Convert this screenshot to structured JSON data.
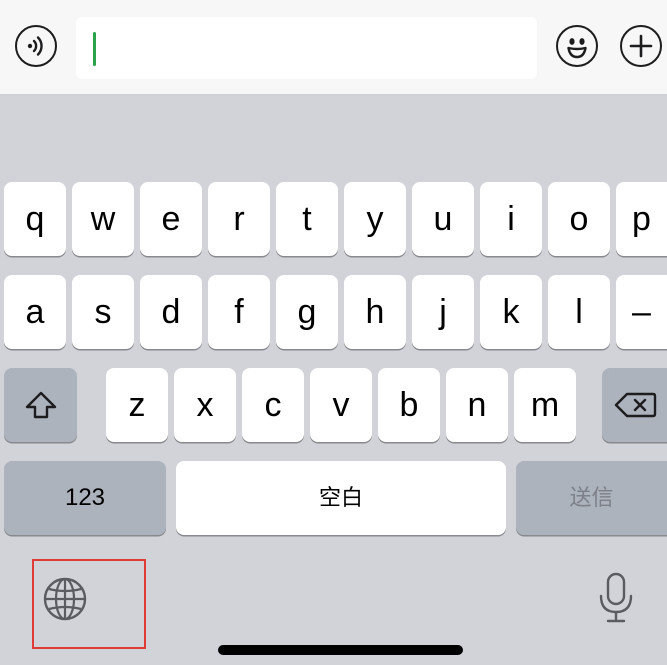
{
  "input": {
    "value": ""
  },
  "keyboard": {
    "row1": [
      "q",
      "w",
      "e",
      "r",
      "t",
      "y",
      "u",
      "i",
      "o",
      "p"
    ],
    "row2": [
      "a",
      "s",
      "d",
      "f",
      "g",
      "h",
      "j",
      "k",
      "l",
      "–"
    ],
    "row3": [
      "z",
      "x",
      "c",
      "v",
      "b",
      "n",
      "m"
    ],
    "numbers_label": "123",
    "space_label": "空白",
    "send_label": "送信"
  },
  "icons": {
    "voice": "voice-wave-icon",
    "emoji": "emoji-icon",
    "add": "plus-icon",
    "shift": "shift-icon",
    "delete": "backspace-icon",
    "globe": "globe-icon",
    "mic": "microphone-icon"
  },
  "colors": {
    "keyboard_bg": "#d1d3d9",
    "key_bg": "#ffffff",
    "function_key_bg": "#adb3bc",
    "caret": "#2aa34a",
    "highlight_box": "#e03b36"
  }
}
